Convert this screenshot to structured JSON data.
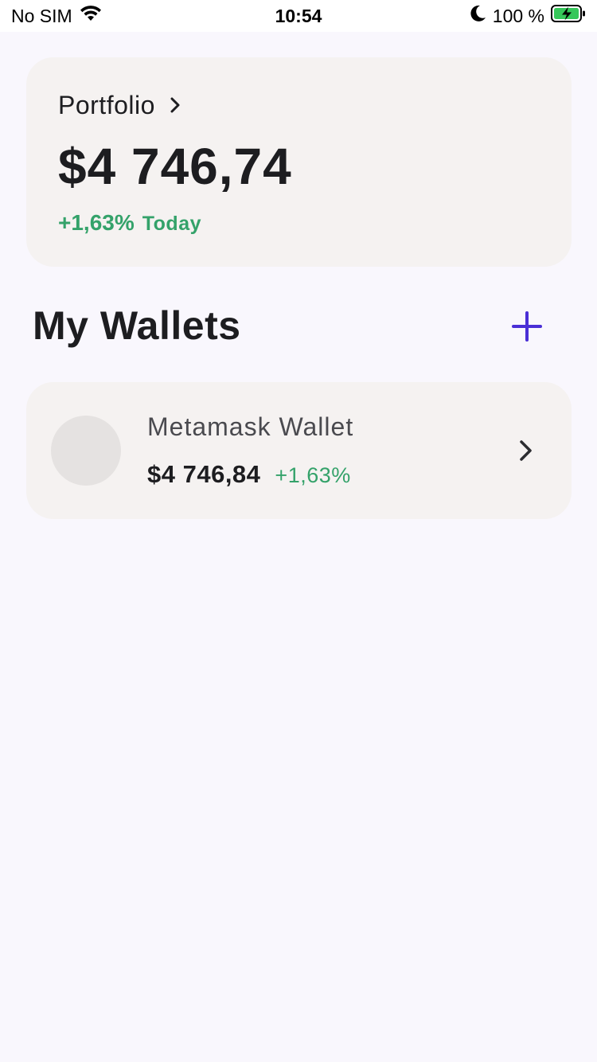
{
  "status_bar": {
    "carrier": "No SIM",
    "time": "10:54",
    "battery": "100 %",
    "icons": [
      "wifi-icon",
      "moon-icon",
      "battery-charging-icon"
    ]
  },
  "portfolio": {
    "label": "Portfolio",
    "value": "$4 746,74",
    "change_pct": "+1,63%",
    "change_period": "Today"
  },
  "wallets_section": {
    "title": "My Wallets",
    "add_icon": "plus-icon",
    "items": [
      {
        "name": "Metamask Wallet",
        "value": "$4 746,84",
        "change": "+1,63%"
      }
    ]
  },
  "colors": {
    "accent": "#4a2fd6",
    "positive": "#34a26a",
    "card": "#f5f2f1",
    "background": "#f9f7fd"
  }
}
